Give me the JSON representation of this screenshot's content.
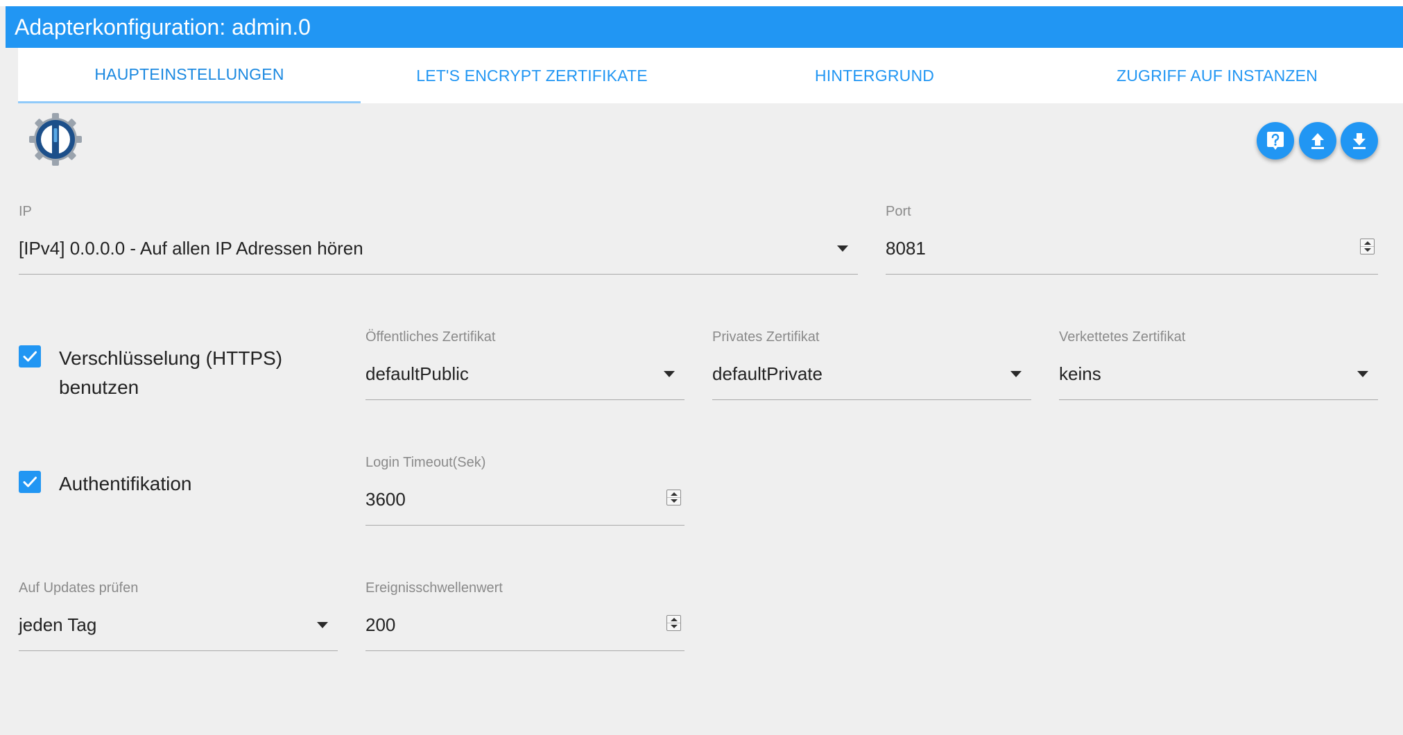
{
  "header": {
    "title": "Adapterkonfiguration: admin.0"
  },
  "tabs": [
    {
      "label": "HAUPTEINSTELLUNGEN",
      "active": true
    },
    {
      "label": "LET'S ENCRYPT ZERTIFIKATE",
      "active": false
    },
    {
      "label": "HINTERGRUND",
      "active": false
    },
    {
      "label": "ZUGRIFF AUF INSTANZEN",
      "active": false
    }
  ],
  "icons": {
    "logo": "iobroker-logo",
    "help": "help-icon",
    "upload": "upload-icon",
    "download": "download-icon",
    "dropdown": "chevron-down-icon"
  },
  "colors": {
    "accent": "#2196f3",
    "background": "#efefef",
    "tab_bar": "#ffffff",
    "active_tab_indicator": "#90caf9",
    "label": "#8a8a8a",
    "logo_dark": "#1c4f8a",
    "logo_gear": "#9aa3ad"
  },
  "form": {
    "ip": {
      "label": "IP",
      "value": "[IPv4] 0.0.0.0 - Auf allen IP Adressen hören"
    },
    "port": {
      "label": "Port",
      "value": "8081"
    },
    "https": {
      "label_line1": "Verschlüsselung (HTTPS)",
      "label_line2": "benutzen",
      "checked": true
    },
    "public_cert": {
      "label": "Öffentliches Zertifikat",
      "value": "defaultPublic"
    },
    "private_cert": {
      "label": "Privates Zertifikat",
      "value": "defaultPrivate"
    },
    "chained_cert": {
      "label": "Verkettetes Zertifikat",
      "value": "keins"
    },
    "auth": {
      "label": "Authentifikation",
      "checked": true
    },
    "login_timeout": {
      "label": "Login Timeout(Sek)",
      "value": "3600"
    },
    "updates": {
      "label": "Auf Updates prüfen",
      "value": "jeden Tag"
    },
    "event_threshold": {
      "label": "Ereignisschwellenwert",
      "value": "200"
    }
  }
}
